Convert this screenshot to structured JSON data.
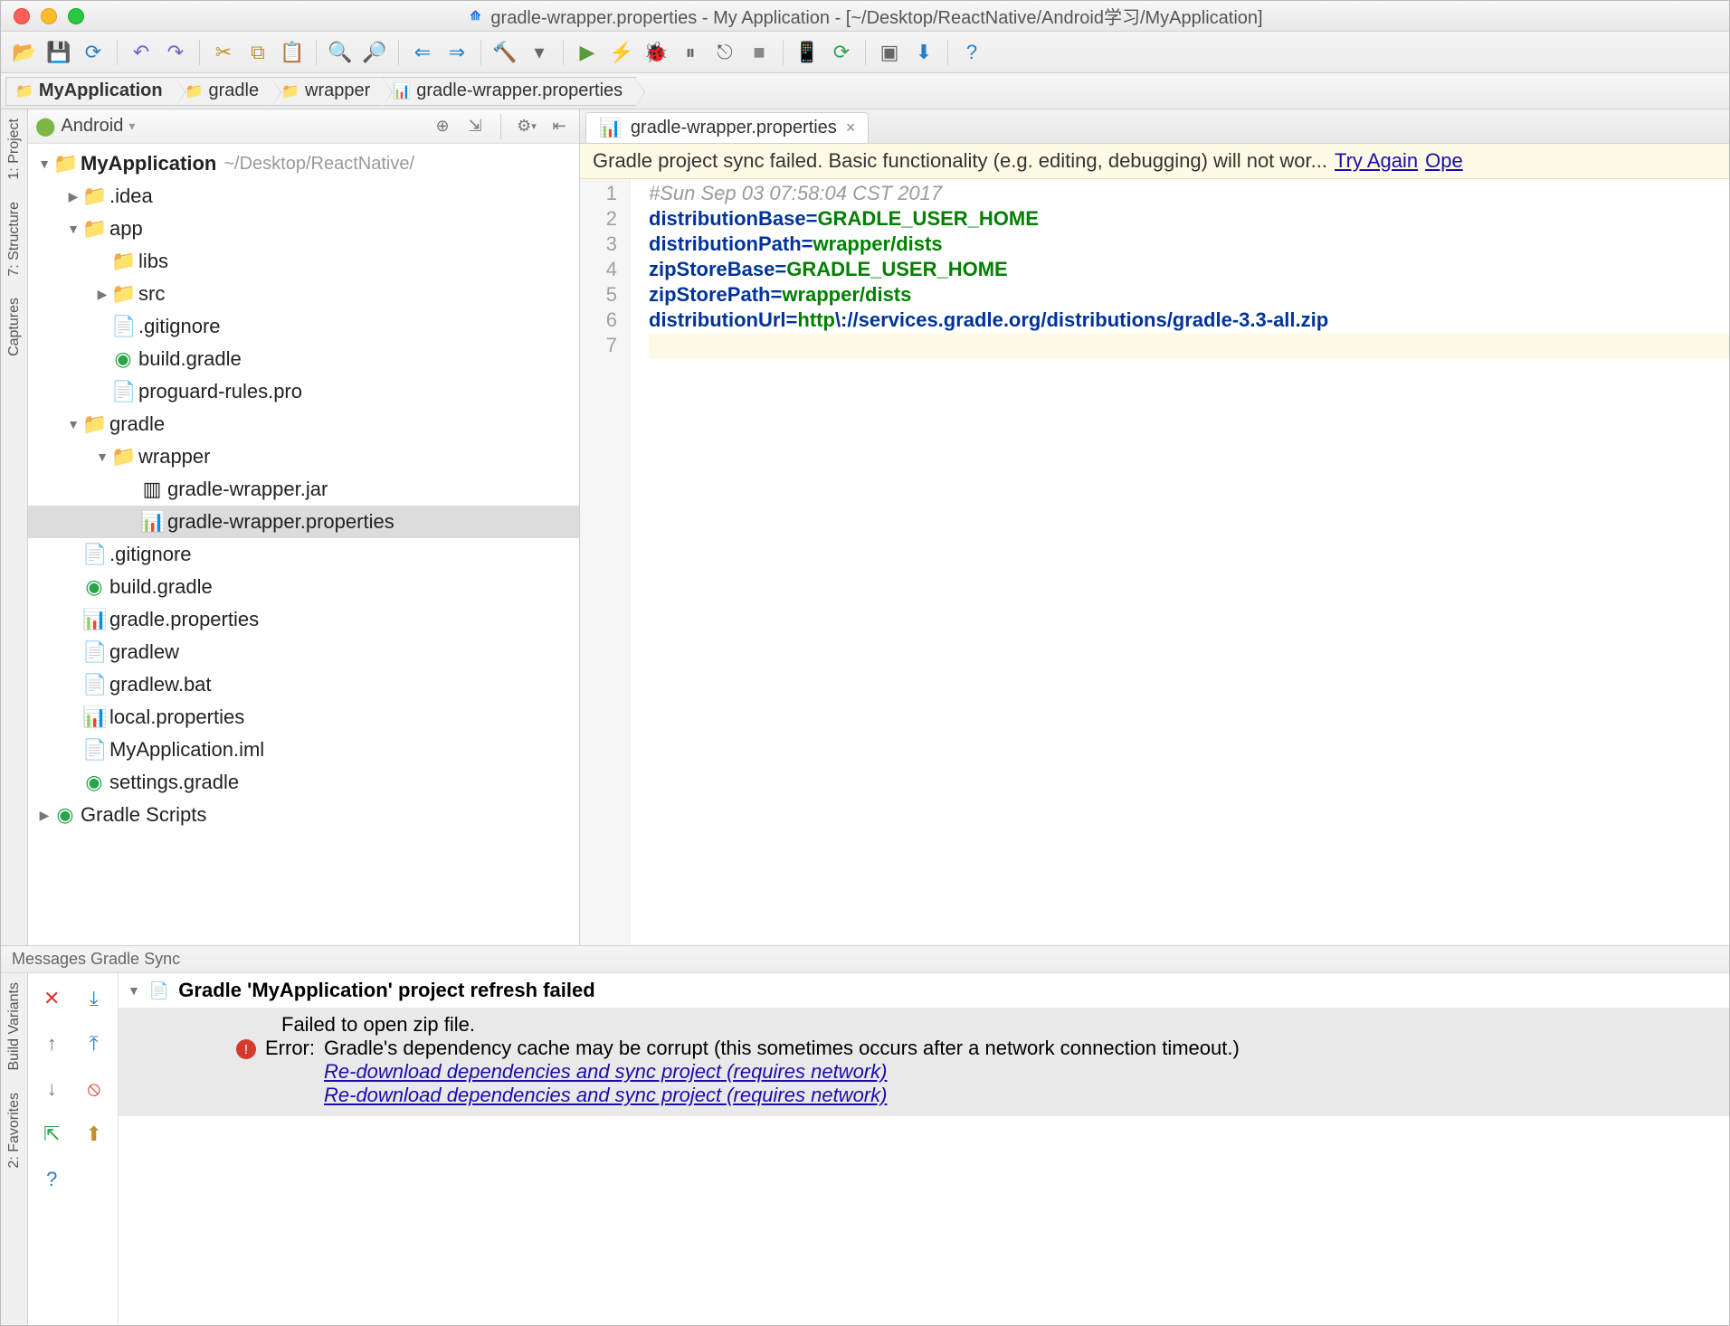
{
  "title": "gradle-wrapper.properties - My Application - [~/Desktop/ReactNative/Android学习/MyApplication]",
  "breadcrumb": [
    {
      "label": "MyApplication",
      "bold": true
    },
    {
      "label": "gradle"
    },
    {
      "label": "wrapper"
    },
    {
      "label": "gradle-wrapper.properties"
    }
  ],
  "projectPanel": {
    "selector": "Android"
  },
  "tree": {
    "root": {
      "label": "MyApplication",
      "sub": "~/Desktop/ReactNative/"
    },
    "items": [
      {
        "indent": 1,
        "arrow": "▶",
        "icon": "📁",
        "label": ".idea"
      },
      {
        "indent": 1,
        "arrow": "▼",
        "icon": "📁",
        "label": "app"
      },
      {
        "indent": 2,
        "arrow": "",
        "icon": "📁",
        "label": "libs"
      },
      {
        "indent": 2,
        "arrow": "▶",
        "icon": "📁",
        "label": "src"
      },
      {
        "indent": 2,
        "arrow": "",
        "icon": "📄",
        "label": ".gitignore"
      },
      {
        "indent": 2,
        "arrow": "",
        "icon": "◉",
        "iconClass": "fi-gradle",
        "label": "build.gradle"
      },
      {
        "indent": 2,
        "arrow": "",
        "icon": "📄",
        "label": "proguard-rules.pro"
      },
      {
        "indent": 1,
        "arrow": "▼",
        "icon": "📁",
        "label": "gradle"
      },
      {
        "indent": 2,
        "arrow": "▼",
        "icon": "📁",
        "label": "wrapper"
      },
      {
        "indent": 3,
        "arrow": "",
        "icon": "▥",
        "label": "gradle-wrapper.jar"
      },
      {
        "indent": 3,
        "arrow": "",
        "icon": "📊",
        "label": "gradle-wrapper.properties",
        "selected": true
      },
      {
        "indent": 1,
        "arrow": "",
        "icon": "📄",
        "label": ".gitignore"
      },
      {
        "indent": 1,
        "arrow": "",
        "icon": "◉",
        "iconClass": "fi-gradle",
        "label": "build.gradle"
      },
      {
        "indent": 1,
        "arrow": "",
        "icon": "📊",
        "label": "gradle.properties"
      },
      {
        "indent": 1,
        "arrow": "",
        "icon": "📄",
        "label": "gradlew"
      },
      {
        "indent": 1,
        "arrow": "",
        "icon": "📄",
        "label": "gradlew.bat"
      },
      {
        "indent": 1,
        "arrow": "",
        "icon": "📊",
        "label": "local.properties"
      },
      {
        "indent": 1,
        "arrow": "",
        "icon": "📄",
        "label": "MyApplication.iml"
      },
      {
        "indent": 1,
        "arrow": "",
        "icon": "◉",
        "iconClass": "fi-gradle",
        "label": "settings.gradle"
      },
      {
        "indent": 0,
        "arrow": "▶",
        "icon": "◉",
        "iconClass": "fi-gradle",
        "label": "Gradle Scripts"
      }
    ]
  },
  "sideTabs": {
    "project": "1: Project",
    "structure": "7: Structure",
    "captures": "Captures",
    "build": "Build Variants",
    "favorites": "2: Favorites"
  },
  "editor": {
    "tab": "gradle-wrapper.properties",
    "banner": {
      "text": "Gradle project sync failed. Basic functionality (e.g. editing, debugging) will not wor...",
      "link1": "Try Again",
      "link2": "Ope"
    },
    "lines": [
      {
        "t": "comment",
        "text": "#Sun Sep 03 07:58:04 CST 2017"
      },
      {
        "t": "kv",
        "k": "distributionBase",
        "v": "GRADLE_USER_HOME"
      },
      {
        "t": "kv",
        "k": "distributionPath",
        "v": "wrapper/dists"
      },
      {
        "t": "kv",
        "k": "zipStoreBase",
        "v": "GRADLE_USER_HOME"
      },
      {
        "t": "kv",
        "k": "zipStorePath",
        "v": "wrapper/dists"
      },
      {
        "t": "url",
        "k": "distributionUrl",
        "v1": "http",
        "v2": "\\://services.gradle.org/distributions/gradle-3.3-all.zip"
      },
      {
        "t": "blank"
      }
    ]
  },
  "messages": {
    "panelTitle": "Messages Gradle Sync",
    "headline": "Gradle 'MyApplication' project refresh failed",
    "line1": "Failed to open zip file.",
    "errorLabel": "Error:",
    "line2": "Gradle's dependency cache may be corrupt (this sometimes occurs after a network connection timeout.)",
    "link": "Re-download dependencies and sync project (requires network)"
  }
}
